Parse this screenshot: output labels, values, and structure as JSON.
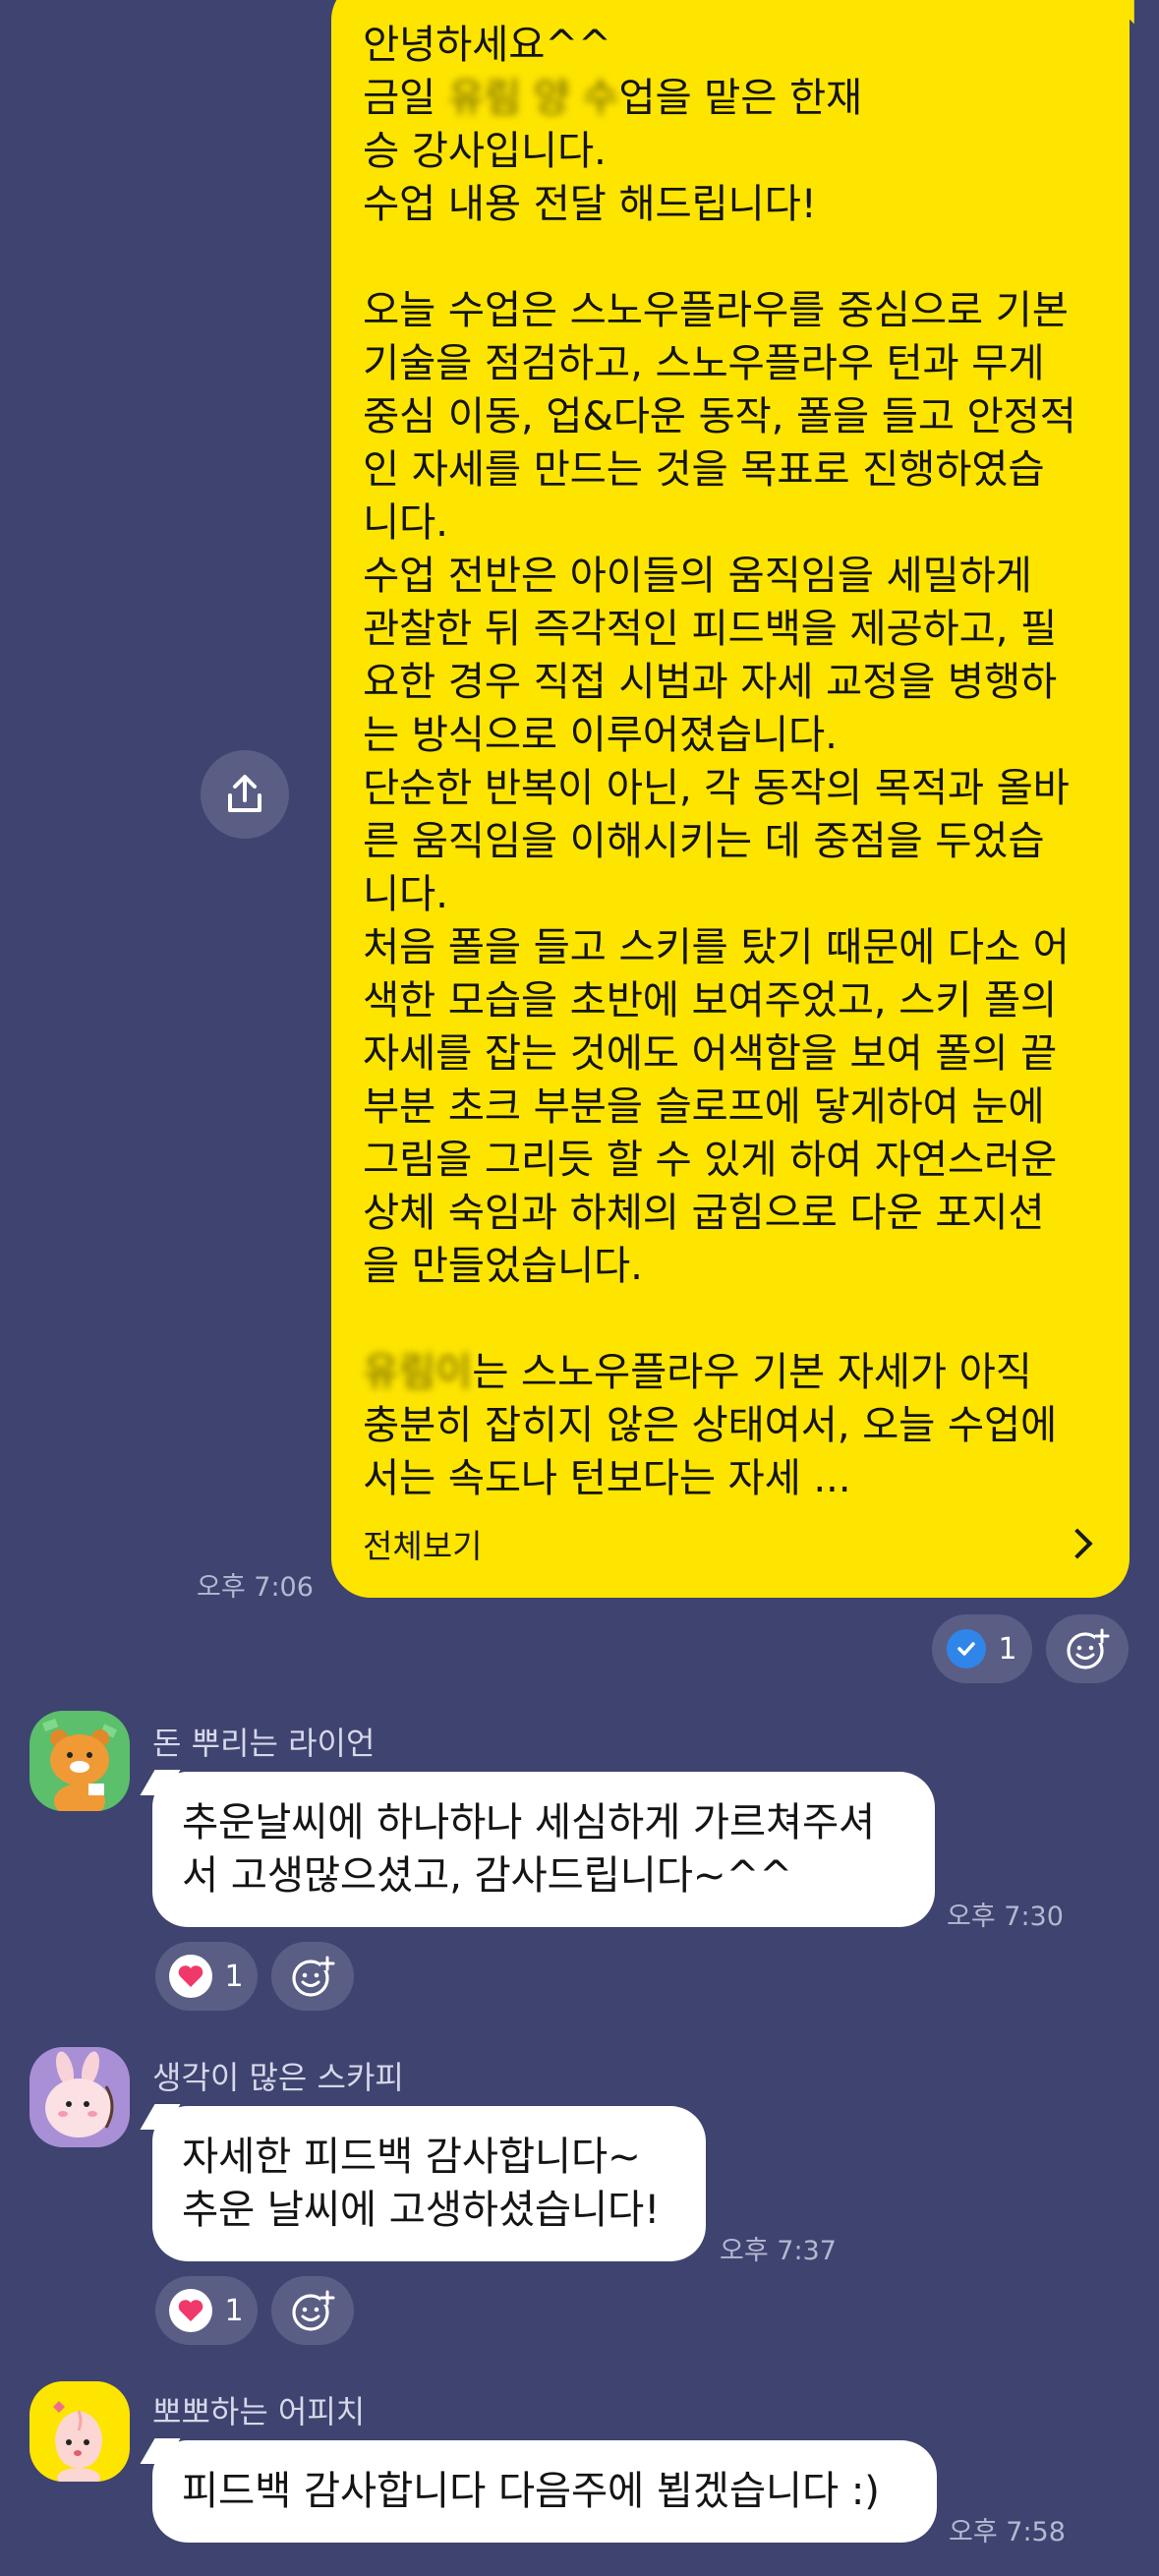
{
  "colors": {
    "background": "#3e4370",
    "my_bubble": "#fee500",
    "other_bubble": "#ffffff",
    "pill": "#5a5e85",
    "check": "#2f86e8",
    "heart": "#f0386b"
  },
  "my_message": {
    "lines": [
      "안녕하세요^^",
      "금일 ",
      "승 강사입니다.",
      "수업 내용 전달 해드립니다!",
      "",
      "오늘 수업은 스노우플라우를 중심으로 기본",
      "기술을 점검하고, 스노우플라우 턴과 무게",
      "중심 이동, 업&다운 동작, 폴을 들고 안정적",
      "인 자세를 만드는 것을 목표로 진행하였습",
      "니다.",
      "수업 전반은 아이들의 움직임을 세밀하게",
      "관찰한 뒤 즉각적인 피드백을 제공하고, 필",
      "요한 경우 직접 시범과 자세 교정을 병행하",
      "는 방식으로 이루어졌습니다.",
      "단순한 반복이 아닌, 각 동작의 목적과 올바",
      "른 움직임을 이해시키는 데 중점을 두었습",
      "니다.",
      "처음 폴을 들고 스키를 탔기 때문에 다소 어",
      "색한 모습을 초반에 보여주었고, 스키 폴의",
      "자세를 잡는 것에도 어색함을 보여 폴의 끝",
      "부분 초크 부분을 슬로프에 닿게하여 눈에",
      "그림을 그리듯 할 수 있게 하여 자연스러운",
      "상체 숙임과 하체의 굽힘으로 다운 포지션",
      "을 만들었습니다.",
      "",
      "",
      "충분히 잡히지 않은 상태여서, 오늘 수업에",
      "서는 속도나 턴보다는 자세 ..."
    ],
    "line2_tail": "업을 맡은 한재",
    "line26_tail": "는 스노우플라우 기본 자세가 아직",
    "see_all": "전체보기",
    "time": "오후 7:06",
    "read_count": "1",
    "share_icon": "share-icon"
  },
  "messages": [
    {
      "sender": "돈 뿌리는 라이언",
      "avatar": "ryan-avatar",
      "text": "추운날씨에 하나하나 세심하게 가르쳐주셔\n서 고생많으셨고, 감사드립니다~^^",
      "time": "오후 7:30",
      "reaction_count": "1"
    },
    {
      "sender": "생각이 많은 스카피",
      "avatar": "scrappy-avatar",
      "text": "자세한 피드백 감사합니다~\n추운 날씨에 고생하셨습니다!",
      "time": "오후 7:37",
      "reaction_count": "1"
    },
    {
      "sender": "뽀뽀하는 어피치",
      "avatar": "apeach-avatar",
      "text": "피드백 감사합니다 다음주에 뵙겠습니다 :)",
      "time": "오후 7:58"
    }
  ]
}
